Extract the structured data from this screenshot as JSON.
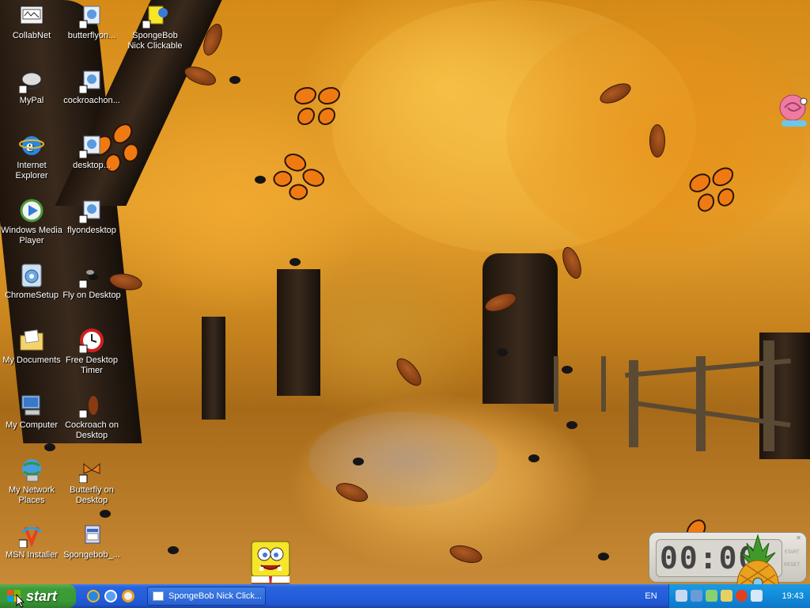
{
  "desktop": {
    "icons": [
      {
        "label": "CollabNet",
        "icon": "collabnet-icon"
      },
      {
        "label": "butterflyon...",
        "icon": "butterfly-shortcut-icon"
      },
      {
        "label": "SpongeBob Nick Clickable",
        "icon": "spongebob-icon"
      },
      {
        "label": "MyPal",
        "icon": "mypal-icon"
      },
      {
        "label": "cockroachon...",
        "icon": "cockroach-shortcut-icon"
      },
      {
        "label": "Internet Explorer",
        "icon": "internet-explorer-icon"
      },
      {
        "label": "desktop...",
        "icon": "desktop-shortcut-icon"
      },
      {
        "label": "Windows Media Player",
        "icon": "windows-media-player-icon"
      },
      {
        "label": "flyondesktop",
        "icon": "fly-shortcut-icon"
      },
      {
        "label": "ChromeSetup",
        "icon": "chrome-setup-icon"
      },
      {
        "label": "Fly on Desktop",
        "icon": "fly-icon"
      },
      {
        "label": "My Documents",
        "icon": "my-documents-icon"
      },
      {
        "label": "Free Desktop Timer",
        "icon": "timer-icon"
      },
      {
        "label": "My Computer",
        "icon": "my-computer-icon"
      },
      {
        "label": "Cockroach on Desktop",
        "icon": "cockroach-icon"
      },
      {
        "label": "My Network Places",
        "icon": "network-places-icon"
      },
      {
        "label": "Butterfly on Desktop",
        "icon": "butterfly-icon"
      },
      {
        "label": "MSN Installer",
        "icon": "msn-installer-icon"
      },
      {
        "label": "Spongebob_...",
        "icon": "installer-icon"
      }
    ]
  },
  "taskbar": {
    "start_label": "start",
    "quick_launch": [
      "internet-explorer-icon",
      "outlook-express-icon",
      "media-player-icon"
    ],
    "task_button_label": "SpongeBob Nick Click...",
    "language": "EN",
    "clock": "19:43"
  },
  "timer_widget": {
    "display": "00:00",
    "start_label": "START",
    "reset_label": "RESET"
  },
  "colors": {
    "taskbar_blue": "#245edb",
    "start_green": "#3a9a35",
    "tray_blue": "#118cd8"
  }
}
